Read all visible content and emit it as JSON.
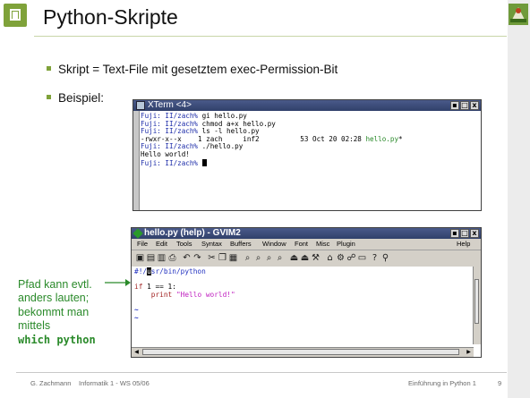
{
  "slide": {
    "title": "Python-Skripte",
    "bullets": [
      "Skript = Text-File mit gesetztem exec-Permission-Bit",
      "Beispiel:"
    ],
    "logo_left": "tree-logo",
    "logo_right": "person-logo"
  },
  "xterm": {
    "title": "XTerm <4>",
    "window_buttons": [
      "▪",
      "□",
      "x"
    ],
    "lines": [
      {
        "prompt": "Fuji: II/zach%",
        "text": " gi hello.py"
      },
      {
        "prompt": "Fuji: II/zach%",
        "text": " chmod a+x hello.py"
      },
      {
        "prompt": "Fuji: II/zach%",
        "text": " ls -l hello.py"
      },
      {
        "prompt": "",
        "text": "-rwxr-x--x    1 zach     inf2          53 Oct 20 02:28 ",
        "extra": "hello.py",
        "extra_suffix": "*"
      },
      {
        "prompt": "Fuji: II/zach%",
        "text": " ./hello.py"
      },
      {
        "prompt": "",
        "text": "Hello world!"
      },
      {
        "prompt": "Fuji: II/zach%",
        "text": " "
      }
    ]
  },
  "gvim": {
    "title": "hello.py (help) - GVIM2",
    "window_buttons": [
      "▪",
      "□",
      "x"
    ],
    "menu": [
      "File",
      "Edit",
      "Tools",
      "Syntax",
      "Buffers",
      "Window",
      "Font",
      "Misc",
      "Plugin",
      "Help"
    ],
    "code": {
      "shebang_head": "#!/",
      "shebang_cursor": "u",
      "shebang_tail": "sr/bin/python",
      "if_kw": "if",
      "if_rest": " 1 == 1:",
      "print_kw": "print",
      "print_str": "\"Hello world!\"",
      "tilde": "~"
    }
  },
  "annotation": {
    "lines": [
      "Pfad kann evtl.",
      "anders lauten;",
      "bekommt man",
      "mittels"
    ],
    "command": "which python"
  },
  "footer": {
    "author": "G. Zachmann",
    "course": "Informatik 1 - WS 05/06",
    "chapter": "Einführung in Python 1",
    "page": "9"
  },
  "colors": {
    "accent": "#7fa23a",
    "annotation": "#2a8a2a",
    "titlebar": "#30406a"
  }
}
